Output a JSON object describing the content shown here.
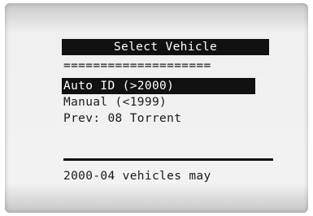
{
  "screen": {
    "title": "Select Vehicle",
    "separator": "====================",
    "menu_items": [
      {
        "label": "Auto ID (>2000)",
        "selected": true
      },
      {
        "label": "Manual (<1999)",
        "selected": false
      },
      {
        "label": "Prev: 08 Torrent",
        "selected": false
      }
    ],
    "footer_text": "2000-04 vehicles may"
  }
}
